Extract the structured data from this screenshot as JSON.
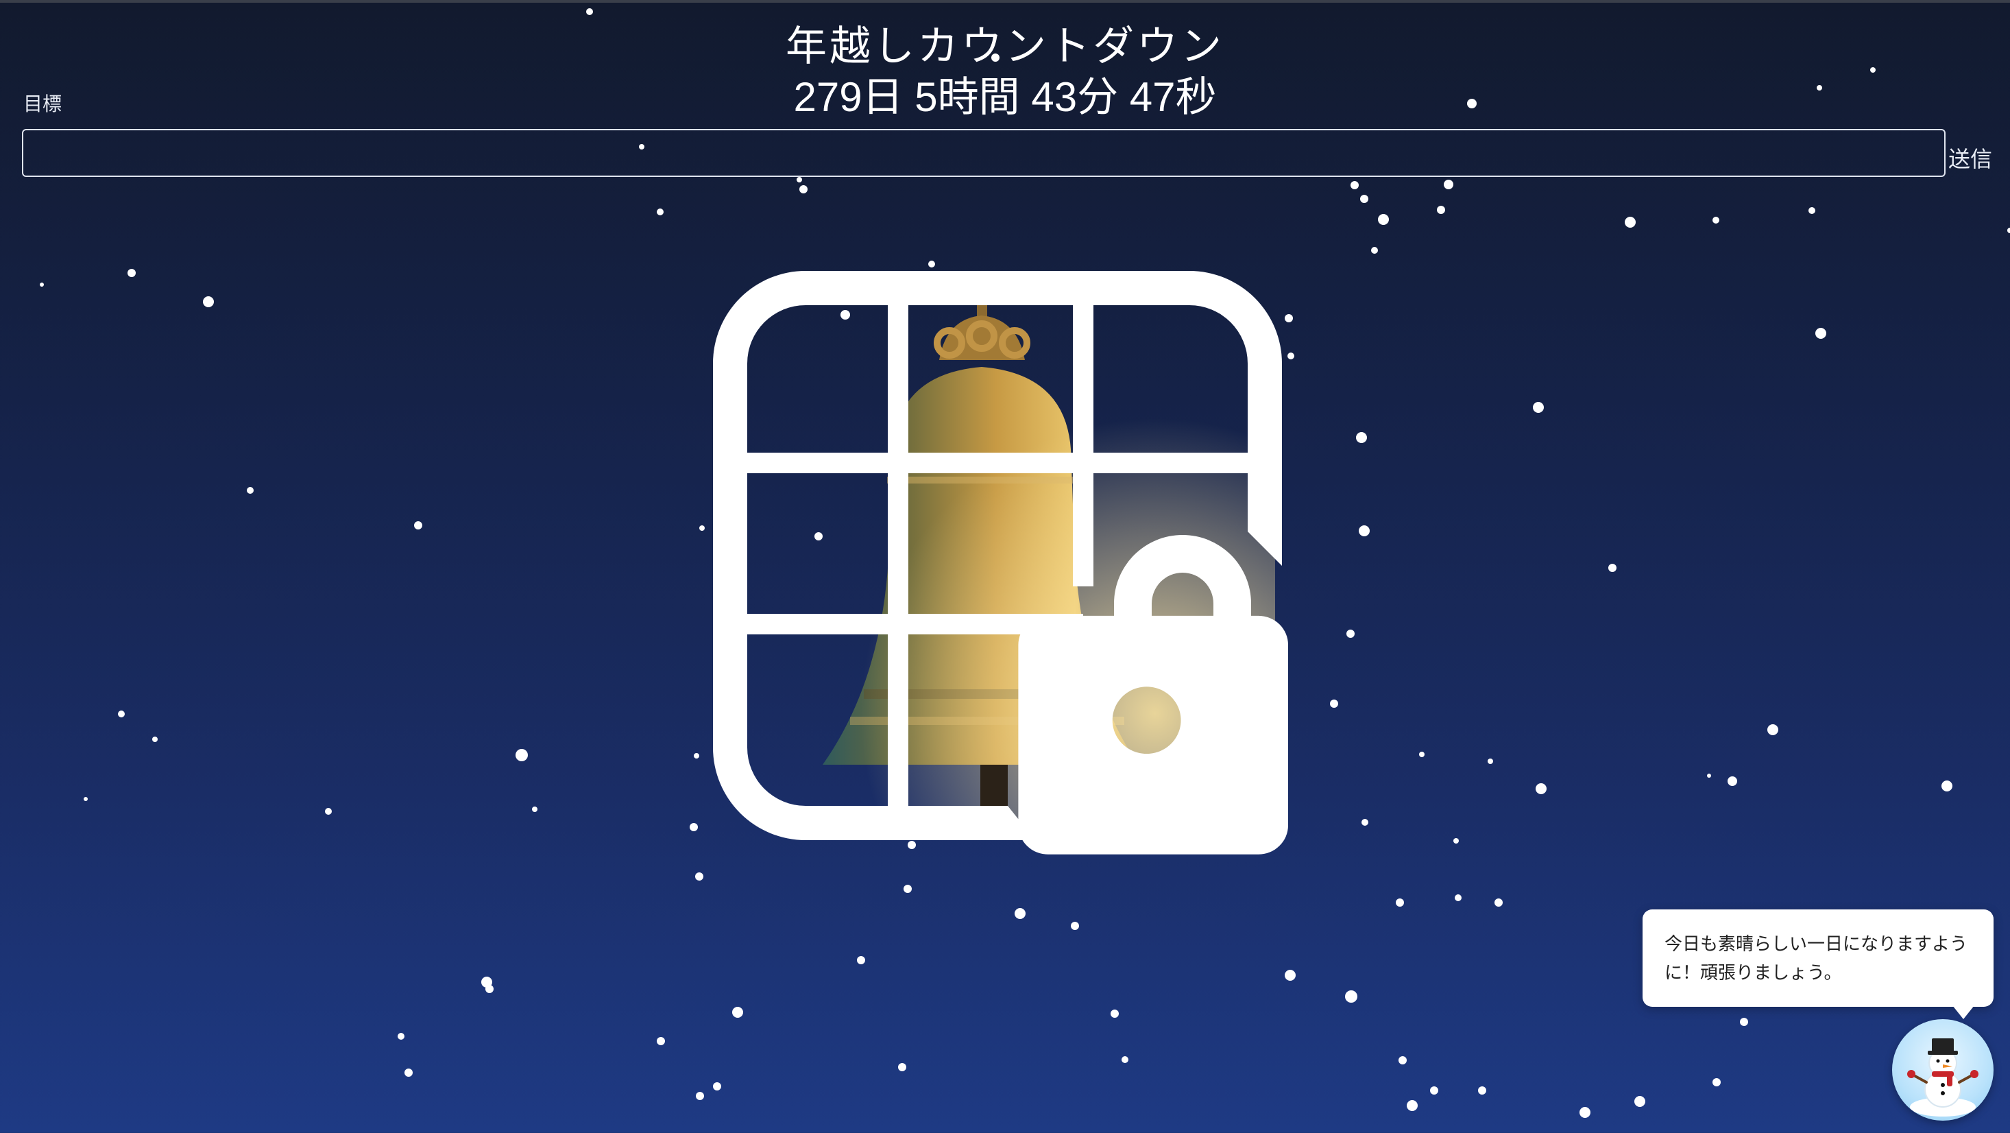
{
  "header": {
    "title": "年越しカウントダウン",
    "countdown": "279日 5時間 43分 47秒"
  },
  "goal_form": {
    "label": "目標",
    "input_value": "",
    "submit_label": "送信"
  },
  "center_graphic": {
    "image": "bell-image",
    "overlay_icon": "grid-lock-icon"
  },
  "mascot": {
    "message": "今日も素晴らしい一日になりますように！頑張りましょう。",
    "avatar_icon": "snowman-icon"
  },
  "colors": {
    "background_top": "#121a2e",
    "background_bottom": "#1e3a84",
    "bell_gold": "#b98f3e"
  }
}
